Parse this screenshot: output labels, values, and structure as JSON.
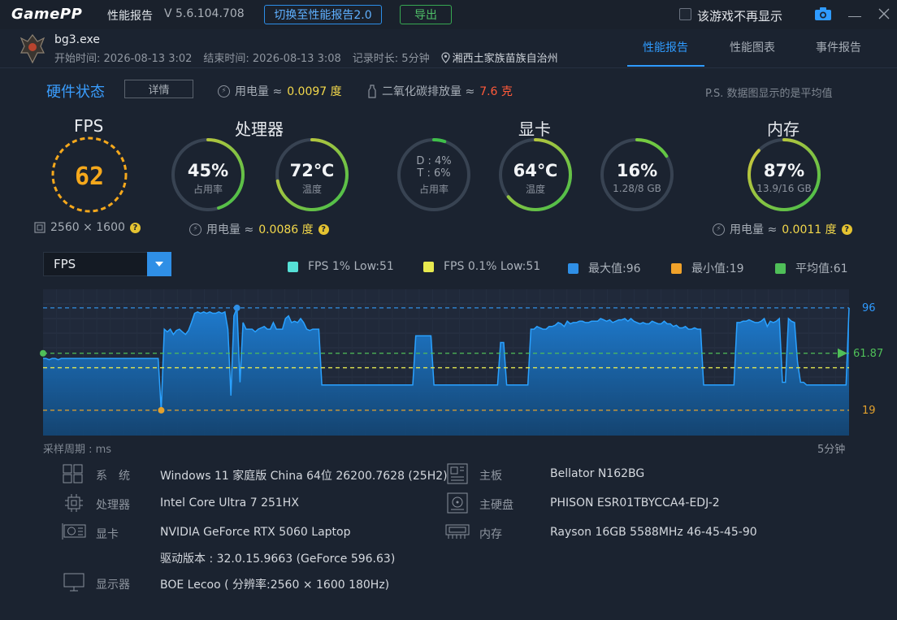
{
  "app": {
    "logo": "GamePP",
    "title": "性能报告",
    "version": "V 5.6.104.708",
    "switch_button": "切换至性能报告2.0",
    "export_button": "导出",
    "no_more_label": "该游戏不再显示"
  },
  "game": {
    "name": "bg3.exe",
    "start": "开始时间: 2026-08-13 3:02",
    "end": "结束时间: 2026-08-13 3:08",
    "duration": "记录时长: 5分钟",
    "location": "湘西土家族苗族自治州"
  },
  "tabs": [
    "性能报告",
    "性能图表",
    "事件报告"
  ],
  "hardware": {
    "title": "硬件状态",
    "details_button": "详情",
    "power_label": "用电量 ≈",
    "power_value": "0.0097 度",
    "co2_label": "二氧化碳排放量 ≈",
    "co2_value": "7.6 克",
    "note": "P.S. 数据图显示的是平均值"
  },
  "fps_block": {
    "title": "FPS",
    "value": "62",
    "resolution": "2560 × 1600"
  },
  "cpu_block": {
    "title": "处理器",
    "usage_value": "45%",
    "usage_label": "占用率",
    "usage_fraction": 0.45,
    "temp_value": "72℃",
    "temp_label": "温度",
    "temp_fraction": 0.72,
    "power_label": "用电量 ≈",
    "power_value": "0.0086 度"
  },
  "gpu_block": {
    "title": "显卡",
    "usage_line1": "D : 4%",
    "usage_line2": "T : 6%",
    "usage_label": "占用率",
    "usage_fraction": 0.05,
    "temp_value": "64℃",
    "temp_label": "温度",
    "temp_fraction": 0.64,
    "vram_value": "16%",
    "vram_sub": "1.28/8 GB",
    "vram_fraction": 0.16
  },
  "mem_block": {
    "title": "内存",
    "usage_value": "87%",
    "usage_sub": "13.9/16 GB",
    "usage_fraction": 0.87,
    "power_label": "用电量 ≈",
    "power_value": "0.0011 度"
  },
  "chart": {
    "selected_metric": "FPS",
    "legend": [
      {
        "label": "FPS 1% Low:51",
        "color": "#56e0d6"
      },
      {
        "label": "FPS 0.1% Low:51",
        "color": "#e7e94f"
      },
      {
        "label": "最大值:96",
        "color": "#2f8fe6"
      },
      {
        "label": "最小值:19",
        "color": "#f0a22a"
      },
      {
        "label": "平均值:61",
        "color": "#4fbf58"
      }
    ],
    "xlabel_left": "采样周期 : ms",
    "xlabel_right": "5分钟",
    "max_label": "96",
    "avg_label": "61.87",
    "min_label": "19"
  },
  "chart_data": {
    "type": "area",
    "title": "",
    "xlabel": "采样周期 : ms",
    "ylabel": "",
    "ylim": [
      0,
      110
    ],
    "reference_lines": {
      "max": 96,
      "avg": 61.87,
      "min": 19,
      "low1": 51,
      "low01": 51
    },
    "series": [
      {
        "name": "FPS",
        "values": [
          58,
          58,
          57,
          58,
          58,
          57,
          58,
          58,
          58,
          58,
          58,
          58,
          58,
          58,
          58,
          58,
          58,
          58,
          58,
          58,
          58,
          58,
          58,
          58,
          58,
          58,
          58,
          58,
          58,
          58,
          58,
          58,
          58,
          58,
          58,
          58,
          58,
          58,
          58,
          19,
          80,
          78,
          80,
          76,
          79,
          80,
          78,
          76,
          79,
          85,
          92,
          93,
          92,
          93,
          92,
          93,
          92,
          92,
          93,
          92,
          93,
          80,
          30,
          90,
          96,
          40,
          85,
          80,
          80,
          80,
          78,
          80,
          81,
          82,
          80,
          80,
          85,
          80,
          80,
          80,
          88,
          90,
          85,
          86,
          85,
          88,
          85,
          80,
          79,
          80,
          80,
          80,
          38,
          38,
          38,
          38,
          38,
          38,
          38,
          38,
          38,
          38,
          38,
          38,
          38,
          38,
          38,
          38,
          38,
          38,
          38,
          38,
          38,
          38,
          38,
          38,
          38,
          38,
          38,
          38,
          38,
          38,
          38,
          75,
          75,
          75,
          75,
          75,
          75,
          38,
          38,
          38,
          38,
          38,
          38,
          38,
          38,
          38,
          38,
          38,
          38,
          38,
          38,
          38,
          38,
          38,
          38,
          38,
          38,
          38,
          38,
          70,
          70,
          38,
          38,
          38,
          38,
          38,
          38,
          38,
          38,
          80,
          80,
          82,
          81,
          80,
          80,
          82,
          82,
          83,
          85,
          84,
          82,
          86,
          84,
          85,
          85,
          86,
          86,
          85,
          85,
          86,
          86,
          86,
          88,
          87,
          86,
          87,
          85,
          86,
          87,
          87,
          88,
          86,
          88,
          86,
          85,
          84,
          85,
          84,
          84,
          86,
          85,
          84,
          84,
          86,
          84,
          84,
          82,
          83,
          81,
          81,
          82,
          80,
          80,
          81,
          80,
          80,
          38,
          38,
          38,
          38,
          38,
          38,
          38,
          38,
          38,
          38,
          38,
          85,
          85,
          86,
          86,
          87,
          86,
          85,
          85,
          86,
          88,
          82,
          86,
          85,
          86,
          88,
          40,
          40,
          88,
          86,
          85,
          55,
          40,
          40,
          38,
          38,
          38,
          38,
          38,
          38,
          38,
          38,
          38,
          38,
          38,
          38,
          38,
          38,
          96
        ]
      }
    ]
  },
  "system_info": {
    "os_label": "系　统",
    "os_value": "Windows 11 家庭版 China 64位 26200.7628 (25H2)",
    "cpu_label": "处理器",
    "cpu_value": "Intel Core Ultra 7 251HX",
    "gpu_label": "显卡",
    "gpu_value": "NVIDIA GeForce RTX 5060 Laptop",
    "driver_value": "驱动版本 : 32.0.15.9663 (GeForce 596.63)",
    "display_label": "显示器",
    "display_value": "BOE Lecoo ( 分辨率:2560 × 1600 180Hz)",
    "board_label": "主板",
    "board_value": "Bellator N162BG",
    "disk_label": "主硬盘",
    "disk_value": "PHISON ESR01TBYCCA4-EDJ-2",
    "mem_label": "内存",
    "mem_value": "Rayson 16GB 5588MHz 46-45-45-90"
  }
}
